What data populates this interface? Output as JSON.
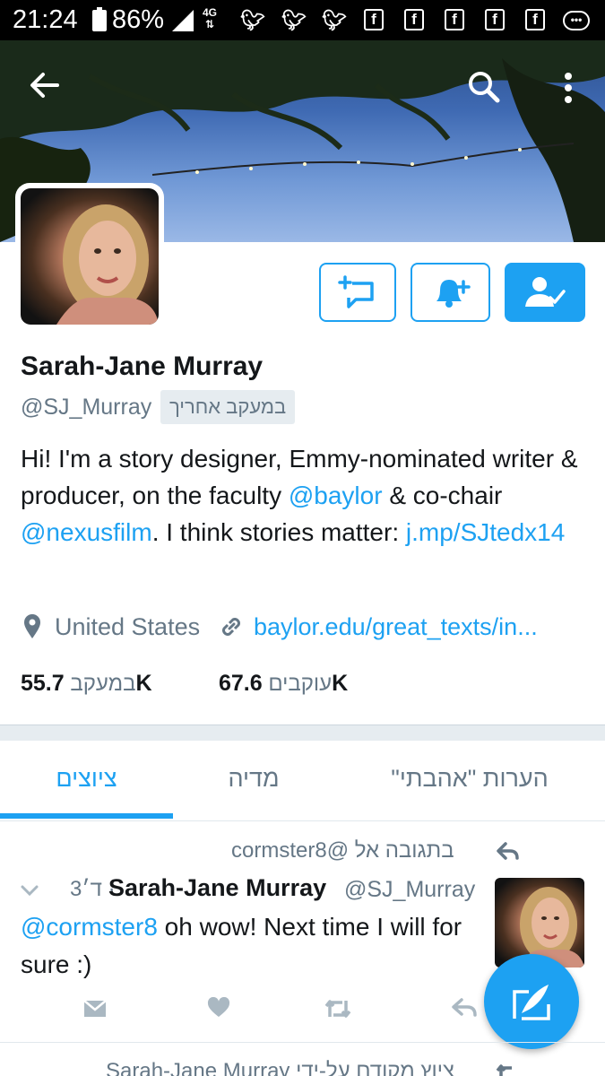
{
  "status_bar": {
    "time": "21:24",
    "battery": "86%",
    "network": "4G"
  },
  "profile": {
    "name": "Sarah-Jane Murray",
    "handle": "@SJ_Murray",
    "follows_you": "במעקב אחריך",
    "bio": {
      "part1": "Hi! I'm a story designer, Emmy-nominated writer & producer, on the faculty ",
      "mention1": "@baylor",
      "part2": " & co-chair ",
      "mention2": "@nexusfilm",
      "part3": ". I think stories matter: ",
      "link": "j.mp/SJtedx14"
    },
    "location": "United States",
    "website": "baylor.edu/great_texts/in...",
    "following": {
      "count": "55.7K",
      "label": "במעקב"
    },
    "followers": {
      "count": "67.6K",
      "label": "עוקבים"
    }
  },
  "tabs": [
    {
      "label": "ציוצים",
      "active": true
    },
    {
      "label": "מדיה",
      "active": false
    },
    {
      "label": "הערות \"אהבתי\"",
      "active": false
    }
  ],
  "tweet": {
    "reply_context": "בתגובה אל @cormster8",
    "author_name": "Sarah-Jane Murray",
    "author_handle": "@SJ_Murray",
    "time": "3ד׳ ·",
    "mention": "@cormster8",
    "text": " oh wow! Next time I will for sure :)"
  },
  "next_tweet": {
    "retweet_context": "ציוץ מקודם על-ידי Sarah-Jane Murray"
  },
  "icons": {
    "back": "arrow-left-icon",
    "search": "search-icon",
    "overflow": "more-vertical-icon",
    "dm": "message-icon",
    "notify": "bell-plus-icon",
    "following": "person-check-icon",
    "location": "map-pin-icon",
    "website": "link-icon",
    "compose": "quill-icon"
  },
  "colors": {
    "accent": "#1da1f2",
    "text": "#14171a",
    "secondary": "#657786"
  }
}
